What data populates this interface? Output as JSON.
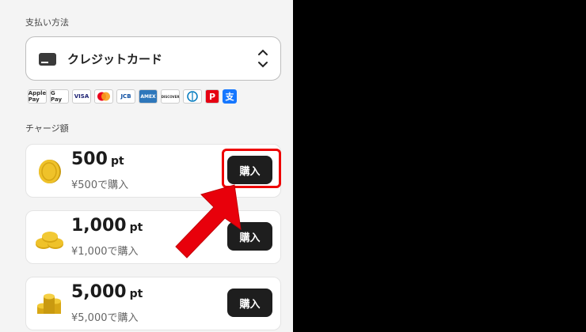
{
  "payment": {
    "section_label": "支払い方法",
    "method": {
      "label": "クレジットカード",
      "icon": "credit-card-icon"
    },
    "brands": [
      "Apple Pay",
      "G Pay",
      "VISA",
      "Mastercard",
      "JCB",
      "AMEX",
      "DISCOVER",
      "Diners",
      "PayPay",
      "Alipay"
    ]
  },
  "charge": {
    "section_label": "チャージ額",
    "options": [
      {
        "amount": "500",
        "unit": "pt",
        "price": "¥500で購入",
        "button": "購入",
        "icon": "coin-icon"
      },
      {
        "amount": "1,000",
        "unit": "pt",
        "price": "¥1,000で購入",
        "button": "購入",
        "icon": "coins-pile-icon"
      },
      {
        "amount": "5,000",
        "unit": "pt",
        "price": "¥5,000で購入",
        "button": "購入",
        "icon": "coins-stack-icon"
      }
    ]
  },
  "colors": {
    "highlight": "#e00000",
    "button_bg": "#1e1e1e",
    "coin": "#e8b818"
  }
}
